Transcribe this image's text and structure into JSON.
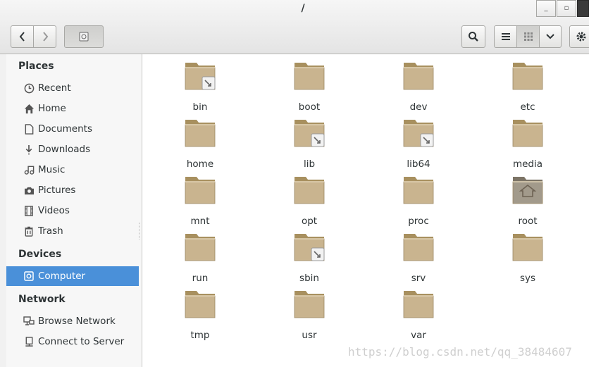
{
  "window": {
    "title": "/"
  },
  "toolbar": {
    "minimize": "_",
    "maximize": "▫"
  },
  "sidebar": {
    "places_header": "Places",
    "places": [
      {
        "label": "Recent",
        "icon": "clock-icon"
      },
      {
        "label": "Home",
        "icon": "home-icon"
      },
      {
        "label": "Documents",
        "icon": "document-icon"
      },
      {
        "label": "Downloads",
        "icon": "download-icon"
      },
      {
        "label": "Music",
        "icon": "music-icon"
      },
      {
        "label": "Pictures",
        "icon": "camera-icon"
      },
      {
        "label": "Videos",
        "icon": "film-icon"
      },
      {
        "label": "Trash",
        "icon": "trash-icon"
      }
    ],
    "devices_header": "Devices",
    "devices": [
      {
        "label": "Computer",
        "icon": "computer-icon",
        "active": true
      }
    ],
    "network_header": "Network",
    "network": [
      {
        "label": "Browse Network",
        "icon": "network-icon"
      },
      {
        "label": "Connect to Server",
        "icon": "server-icon"
      }
    ]
  },
  "folders": [
    {
      "name": "bin",
      "link": true
    },
    {
      "name": "boot"
    },
    {
      "name": "dev"
    },
    {
      "name": "etc"
    },
    {
      "name": "home"
    },
    {
      "name": "lib",
      "link": true
    },
    {
      "name": "lib64",
      "link": true
    },
    {
      "name": "media"
    },
    {
      "name": "mnt"
    },
    {
      "name": "opt"
    },
    {
      "name": "proc"
    },
    {
      "name": "root",
      "home": true
    },
    {
      "name": "run"
    },
    {
      "name": "sbin",
      "link": true
    },
    {
      "name": "srv"
    },
    {
      "name": "sys"
    },
    {
      "name": "tmp"
    },
    {
      "name": "usr"
    },
    {
      "name": "var"
    }
  ],
  "watermark": "https://blog.csdn.net/qq_38484607",
  "colors": {
    "accent": "#4a90d9",
    "folder": "#c9b48f"
  }
}
